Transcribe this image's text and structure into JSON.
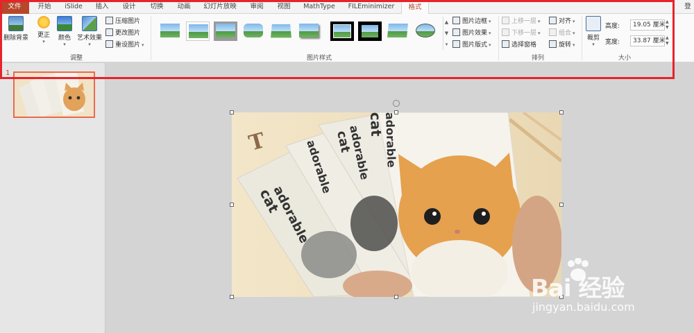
{
  "tabs": [
    "文件",
    "开始",
    "iSlide",
    "插入",
    "设计",
    "切换",
    "动画",
    "幻灯片放映",
    "审阅",
    "视图",
    "MathType",
    "FILEminimizer",
    "格式"
  ],
  "login": "登",
  "ribbon": {
    "remove_bg": "删除背景",
    "correct": "更正",
    "color": "颜色",
    "artistic": "艺术效果",
    "compress": "压缩图片",
    "change": "更改图片",
    "reset": "重设图片",
    "adjust_group": "调整",
    "styles_group": "图片样式",
    "pic_border": "图片边框",
    "pic_effect": "图片效果",
    "pic_layout": "图片版式",
    "bring_forward": "上移一层",
    "send_backward": "下移一层",
    "selection_pane": "选择窗格",
    "align": "对齐",
    "group": "组合",
    "rotate": "旋转",
    "arrange_group": "排列",
    "crop": "裁剪",
    "height_label": "高度:",
    "height_value": "19.05 厘米",
    "width_label": "宽度:",
    "width_value": "33.87 厘米",
    "size_group": "大小"
  },
  "slide_panel": {
    "slide_number": "1"
  },
  "photo": {
    "book_texts": [
      "adorable",
      "cat"
    ]
  },
  "watermark": {
    "brand": "Bai 经验",
    "url": "jingyan.baidu.com"
  },
  "colors": {
    "accent": "#b7472a",
    "highlight": "#e6232b"
  }
}
